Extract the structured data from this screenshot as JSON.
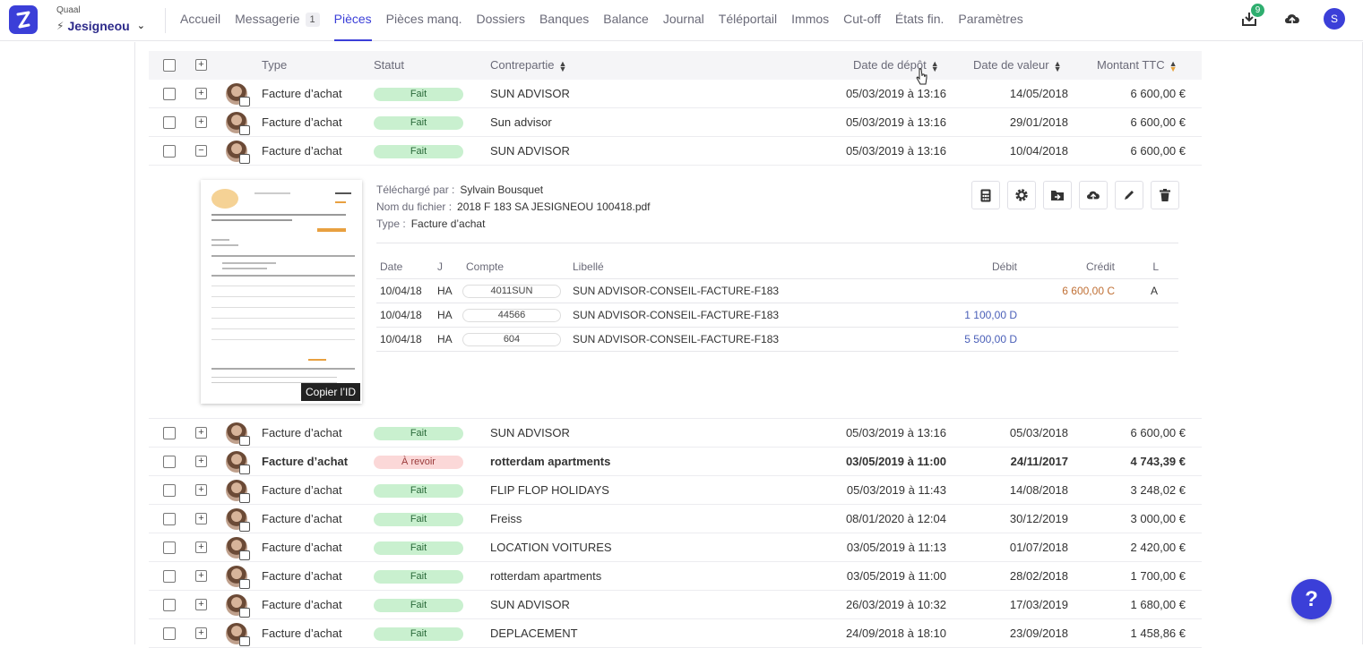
{
  "app": {
    "company_label": "Quaal",
    "company_name": "Jesigneou"
  },
  "nav": [
    {
      "label": "Accueil"
    },
    {
      "label": "Messagerie",
      "count": "1"
    },
    {
      "label": "Pièces",
      "active": true
    },
    {
      "label": "Pièces manq."
    },
    {
      "label": "Dossiers"
    },
    {
      "label": "Banques"
    },
    {
      "label": "Balance"
    },
    {
      "label": "Journal"
    },
    {
      "label": "Téléportail"
    },
    {
      "label": "Immos"
    },
    {
      "label": "Cut-off"
    },
    {
      "label": "États fin."
    },
    {
      "label": "Paramètres"
    }
  ],
  "topbar": {
    "inbox_badge": "9",
    "user_initial": "S",
    "icons": [
      "inbox-icon",
      "cloud-upload-icon",
      "user-avatar"
    ]
  },
  "table": {
    "headers": {
      "type": "Type",
      "status": "Statut",
      "counterparty": "Contrepartie",
      "deposit_date": "Date de dépôt",
      "value_date": "Date de valeur",
      "amount": "Montant TTC"
    },
    "rows_before": [
      {
        "type": "Facture d’achat",
        "status": "Fait",
        "status_kind": "ok",
        "counterparty": "SUN ADVISOR",
        "deposit": "05/03/2019 à 13:16",
        "value": "14/05/2018",
        "amount": "6 600,00 €",
        "expand": "+"
      },
      {
        "type": "Facture d’achat",
        "status": "Fait",
        "status_kind": "ok",
        "counterparty": "Sun advisor",
        "deposit": "05/03/2019 à 13:16",
        "value": "29/01/2018",
        "amount": "6 600,00 €",
        "expand": "+"
      },
      {
        "type": "Facture d’achat",
        "status": "Fait",
        "status_kind": "ok",
        "counterparty": "SUN ADVISOR",
        "deposit": "05/03/2019 à 13:16",
        "value": "10/04/2018",
        "amount": "6 600,00 €",
        "expand": "−"
      }
    ],
    "rows_after": [
      {
        "type": "Facture d’achat",
        "status": "Fait",
        "status_kind": "ok",
        "counterparty": "SUN ADVISOR",
        "deposit": "05/03/2019 à 13:16",
        "value": "05/03/2018",
        "amount": "6 600,00 €",
        "expand": "+"
      },
      {
        "type": "Facture d’achat",
        "status": "À revoir",
        "status_kind": "review",
        "counterparty": "rotterdam apartments",
        "deposit": "03/05/2019 à 11:00",
        "value": "24/11/2017",
        "amount": "4 743,39 €",
        "expand": "+",
        "bold": true
      },
      {
        "type": "Facture d’achat",
        "status": "Fait",
        "status_kind": "ok",
        "counterparty": "FLIP FLOP HOLIDAYS",
        "deposit": "05/03/2019 à 11:43",
        "value": "14/08/2018",
        "amount": "3 248,02 €",
        "expand": "+"
      },
      {
        "type": "Facture d’achat",
        "status": "Fait",
        "status_kind": "ok",
        "counterparty": "Freiss",
        "deposit": "08/01/2020 à 12:04",
        "value": "30/12/2019",
        "amount": "3 000,00 €",
        "expand": "+"
      },
      {
        "type": "Facture d’achat",
        "status": "Fait",
        "status_kind": "ok",
        "counterparty": "LOCATION VOITURES",
        "deposit": "03/05/2019 à 11:13",
        "value": "01/07/2018",
        "amount": "2 420,00 €",
        "expand": "+"
      },
      {
        "type": "Facture d’achat",
        "status": "Fait",
        "status_kind": "ok",
        "counterparty": "rotterdam apartments",
        "deposit": "03/05/2019 à 11:00",
        "value": "28/02/2018",
        "amount": "1 700,00 €",
        "expand": "+"
      },
      {
        "type": "Facture d’achat",
        "status": "Fait",
        "status_kind": "ok",
        "counterparty": "SUN ADVISOR",
        "deposit": "26/03/2019 à 10:32",
        "value": "17/03/2019",
        "amount": "1 680,00 €",
        "expand": "+"
      },
      {
        "type": "Facture d’achat",
        "status": "Fait",
        "status_kind": "ok",
        "counterparty": "DEPLACEMENT",
        "deposit": "24/09/2018 à 18:10",
        "value": "23/09/2018",
        "amount": "1 458,86 €",
        "expand": "+"
      }
    ]
  },
  "detail": {
    "uploaded_by_label": "Téléchargé par :",
    "uploaded_by": "Sylvain Bousquet",
    "filename_label": "Nom du fichier :",
    "filename": "2018 F 183 SA JESIGNEOU 100418.pdf",
    "type_label": "Type :",
    "type": "Facture d’achat",
    "copy_id": "Copier l’ID",
    "actions": [
      "calculator-icon",
      "gear-icon",
      "folder-move-icon",
      "cloud-upload-icon",
      "pencil-icon",
      "trash-icon"
    ],
    "journal": {
      "headers": {
        "date": "Date",
        "j": "J",
        "account": "Compte",
        "label": "Libellé",
        "debit": "Débit",
        "credit": "Crédit",
        "l": "L"
      },
      "lines": [
        {
          "date": "10/04/18",
          "j": "HA",
          "account": "4011SUN",
          "label": "SUN ADVISOR-CONSEIL-FACTURE-F183",
          "debit": "",
          "credit": "6 600,00 C",
          "l": "A"
        },
        {
          "date": "10/04/18",
          "j": "HA",
          "account": "44566",
          "label": "SUN ADVISOR-CONSEIL-FACTURE-F183",
          "debit": "1 100,00 D",
          "credit": "",
          "l": ""
        },
        {
          "date": "10/04/18",
          "j": "HA",
          "account": "604",
          "label": "SUN ADVISOR-CONSEIL-FACTURE-F183",
          "debit": "5 500,00 D",
          "credit": "",
          "l": ""
        }
      ]
    }
  },
  "help_label": "?"
}
